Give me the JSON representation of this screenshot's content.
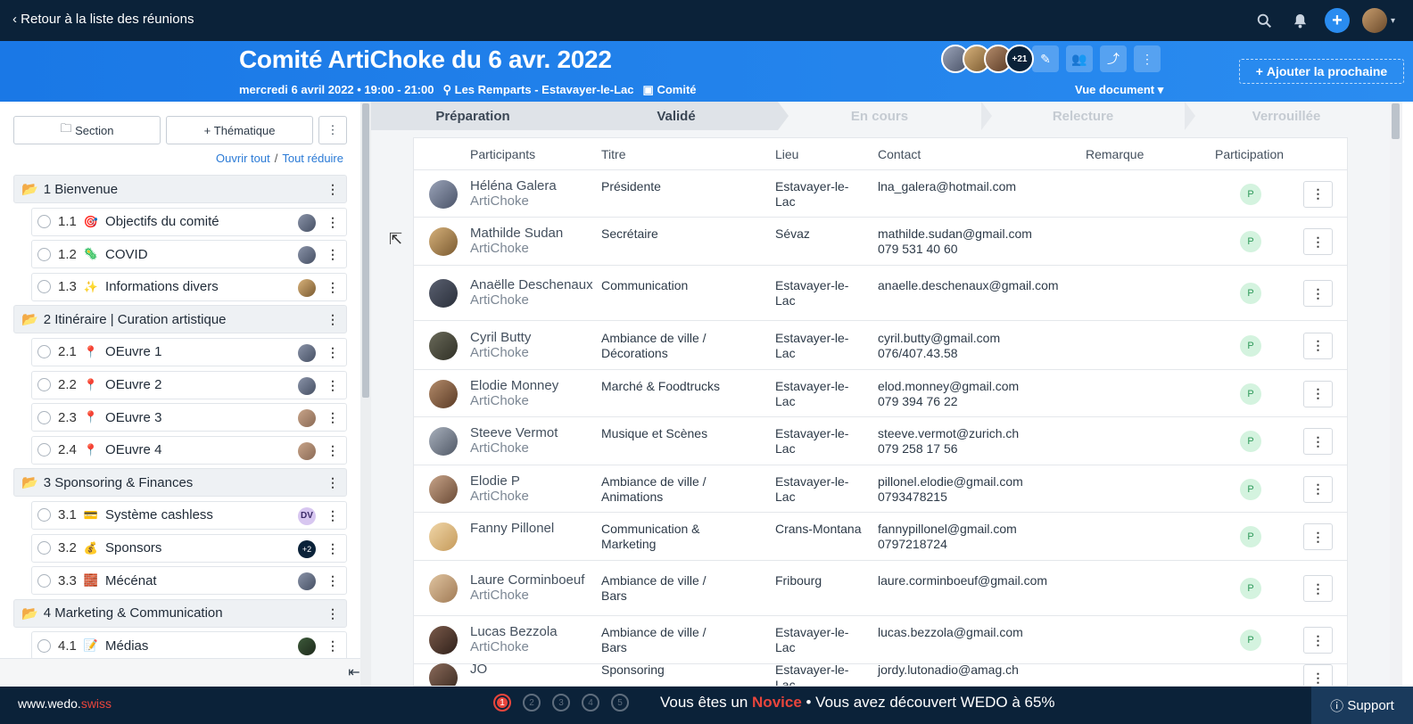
{
  "topbar": {
    "back_label": "Retour à la liste des réunions",
    "icons": [
      "search-icon",
      "bell-icon",
      "add-icon",
      "user-avatar"
    ]
  },
  "header": {
    "title": "Comité ArtiChoke du 6 avr. 2022",
    "date_time": "mercredi 6 avril 2022 • 19:00 - 21:00",
    "location": "Les Remparts - Estavayer-le-Lac",
    "category": "Comité",
    "participants_more": "+21",
    "view_label": "Vue document",
    "add_next_label": "Ajouter la prochaine"
  },
  "sidebar": {
    "section_btn": "Section",
    "theme_btn": "Thématique",
    "open_all": "Ouvrir tout",
    "separator": "/",
    "collapse_all": "Tout réduire",
    "sections": [
      {
        "num": "1",
        "label": "Bienvenue",
        "items": [
          {
            "num": "1.1",
            "emoji": "🎯",
            "label": "Objectifs du comité"
          },
          {
            "num": "1.2",
            "emoji": "🦠",
            "label": "COVID"
          },
          {
            "num": "1.3",
            "emoji": "✨",
            "label": "Informations divers"
          }
        ]
      },
      {
        "num": "2",
        "label": "Itinéraire | Curation artistique",
        "items": [
          {
            "num": "2.1",
            "emoji": "📍",
            "label": "OEuvre 1"
          },
          {
            "num": "2.2",
            "emoji": "📍",
            "label": "OEuvre 2"
          },
          {
            "num": "2.3",
            "emoji": "📍",
            "label": "OEuvre 3"
          },
          {
            "num": "2.4",
            "emoji": "📍",
            "label": "OEuvre 4"
          }
        ]
      },
      {
        "num": "3",
        "label": "Sponsoring & Finances",
        "items": [
          {
            "num": "3.1",
            "emoji": "💳",
            "label": "Système cashless",
            "avatar_text": "DV"
          },
          {
            "num": "3.2",
            "emoji": "💰",
            "label": "Sponsors",
            "avatar_text": "+2"
          },
          {
            "num": "3.3",
            "emoji": "🧱",
            "label": "Mécénat"
          }
        ]
      },
      {
        "num": "4",
        "label": "Marketing & Communication",
        "items": [
          {
            "num": "4.1",
            "emoji": "📝",
            "label": "Médias"
          }
        ]
      }
    ]
  },
  "steps": [
    "Préparation",
    "Validé",
    "En cours",
    "Relecture",
    "Verrouillée"
  ],
  "table": {
    "headers": [
      "Participants",
      "Titre",
      "Lieu",
      "Contact",
      "Remarque",
      "Participation"
    ],
    "rows": [
      {
        "name": "Héléna Galera",
        "org": "ArtiChoke",
        "title": "Présidente",
        "place": "Estavayer-le-Lac",
        "email": "lna_galera@hotmail.com",
        "phone": "",
        "participation": "P"
      },
      {
        "name": "Mathilde Sudan",
        "org": "ArtiChoke",
        "title": "Secrétaire",
        "place": "Sévaz",
        "email": "mathilde.sudan@gmail.com",
        "phone": "079 531 40 60",
        "participation": "P"
      },
      {
        "name": "Anaëlle Deschenaux",
        "org": "ArtiChoke",
        "title": "Communication",
        "place": "Estavayer-le-Lac",
        "email": "anaelle.deschenaux@gmail.com",
        "phone": "",
        "participation": "P"
      },
      {
        "name": "Cyril Butty",
        "org": "ArtiChoke",
        "title": "Ambiance de ville / Décorations",
        "place": "Estavayer-le-Lac",
        "email": "cyril.butty@gmail.com",
        "phone": "076/407.43.58",
        "participation": "P"
      },
      {
        "name": "Elodie Monney",
        "org": "ArtiChoke",
        "title": "Marché & Foodtrucks",
        "place": "Estavayer-le-Lac",
        "email": "elod.monney@gmail.com",
        "phone": "079 394 76 22",
        "participation": "P"
      },
      {
        "name": "Steeve Vermot",
        "org": "ArtiChoke",
        "title": "Musique et Scènes",
        "place": "Estavayer-le-Lac",
        "email": "steeve.vermot@zurich.ch",
        "phone": "079 258 17 56",
        "participation": "P"
      },
      {
        "name": "Elodie P",
        "org": "ArtiChoke",
        "title": "Ambiance de ville / Animations",
        "place": "Estavayer-le-Lac",
        "email": "pillonel.elodie@gmail.com",
        "phone": "0793478215",
        "participation": "P"
      },
      {
        "name": "Fanny Pillonel",
        "org": "",
        "title": "Communication & Marketing",
        "place": "Crans-Montana",
        "email": "fannypillonel@gmail.com",
        "phone": "0797218724",
        "participation": "P"
      },
      {
        "name": "Laure Corminboeuf",
        "org": "ArtiChoke",
        "title": "Ambiance de ville / Bars",
        "place": "Fribourg",
        "email": "laure.corminboeuf@gmail.com",
        "phone": "",
        "participation": "P"
      },
      {
        "name": "Lucas Bezzola",
        "org": "ArtiChoke",
        "title": "Ambiance de ville / Bars",
        "place": "Estavayer-le-Lac",
        "email": "lucas.bezzola@gmail.com",
        "phone": "",
        "participation": "P"
      },
      {
        "name": "JO",
        "org": "",
        "title": "Sponsoring",
        "place": "Estavayer-le-Lac",
        "email": "jordy.lutonadio@amag.ch",
        "phone": "",
        "participation": ""
      }
    ]
  },
  "footer": {
    "site_main": "www.wedo.",
    "site_tld": "swiss",
    "steps": [
      "1",
      "2",
      "3",
      "4",
      "5"
    ],
    "msg_pre": "Vous êtes un ",
    "msg_level": "Novice",
    "msg_post": " • Vous avez découvert WEDO à 65%",
    "support_label": "Support"
  },
  "colors": {
    "topbar_bg": "#0b2239",
    "header_blue": "#1a78e6",
    "accent_red": "#e8453c",
    "badge_green": "#d4f3df"
  }
}
